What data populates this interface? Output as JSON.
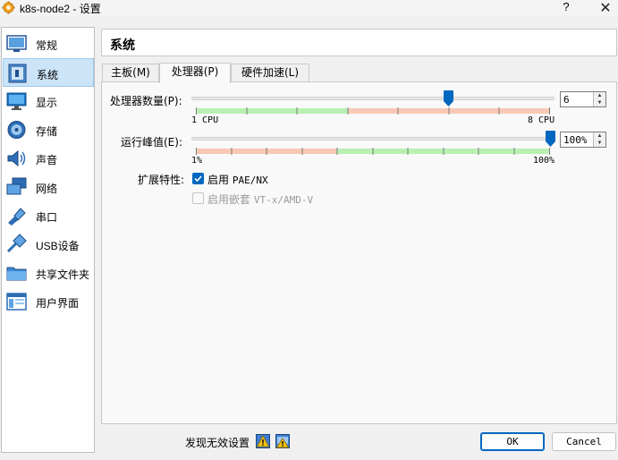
{
  "window": {
    "title": "k8s-node2 - 设置",
    "help": "?",
    "close": "✕"
  },
  "sidebar": {
    "items": [
      {
        "label": "常规",
        "icon": "general-icon"
      },
      {
        "label": "系统",
        "icon": "system-icon",
        "selected": true
      },
      {
        "label": "显示",
        "icon": "display-icon"
      },
      {
        "label": "存储",
        "icon": "storage-icon"
      },
      {
        "label": "声音",
        "icon": "audio-icon"
      },
      {
        "label": "网络",
        "icon": "network-icon"
      },
      {
        "label": "串口",
        "icon": "serial-port-icon"
      },
      {
        "label": "USB设备",
        "icon": "usb-icon"
      },
      {
        "label": "共享文件夹",
        "icon": "shared-folder-icon"
      },
      {
        "label": "用户界面",
        "icon": "user-interface-icon"
      }
    ]
  },
  "header": {
    "title": "系统"
  },
  "tabs": [
    {
      "label": "主板(M)"
    },
    {
      "label": "处理器(P)",
      "active": true
    },
    {
      "label": "硬件加速(L)"
    }
  ],
  "processor": {
    "cpu_count_label": "处理器数量(P):",
    "cpu_count_value": "6",
    "cpu_min_label": "1 CPU",
    "cpu_max_label": "8 CPU",
    "cpu_count": 6,
    "cpu_min": 1,
    "cpu_max": 8,
    "exec_cap_label": "运行峰值(E):",
    "exec_cap_value": "100%",
    "exec_cap": 100,
    "exec_min_label": "1%",
    "exec_max_label": "100%",
    "features_label": "扩展特性:",
    "pae_label": "启用",
    "pae_suffix": "PAE/NX",
    "pae_checked": true,
    "nested_label": "启用嵌套",
    "nested_suffix": "VT-x/AMD-V",
    "nested_checked": false,
    "nested_enabled": false
  },
  "footer": {
    "invalid_settings": "发现无效设置",
    "ok": "OK",
    "cancel": "Cancel"
  },
  "colors": {
    "accent": "#0067c0",
    "green_zone": "#b9f0b2",
    "red_zone": "#f8c8b4",
    "selected_bg": "#cce4f7"
  }
}
